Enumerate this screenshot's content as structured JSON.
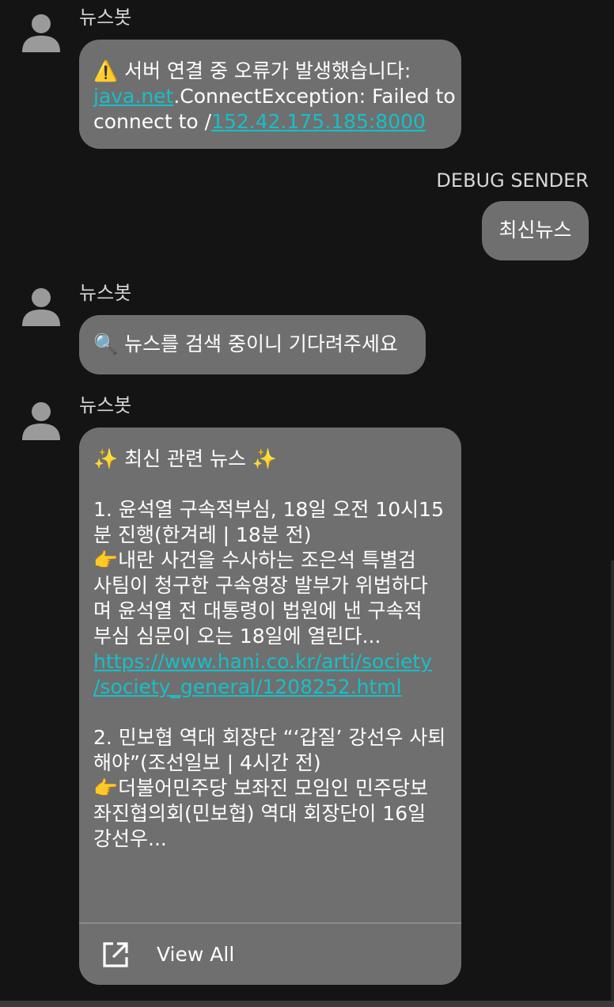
{
  "messages": [
    {
      "sender": "뉴스봇",
      "lines": [
        "⚠️ 서버 연결 중 오류가 발생했습니다:",
        "java.net",
        ".ConnectException: Failed to",
        "connect to /",
        "152.42.175.185:8000"
      ]
    },
    {
      "sender": "DEBUG SENDER",
      "text": "최신뉴스"
    },
    {
      "sender": "뉴스봇",
      "text": "🔍 뉴스를 검색 중이니 기다려주세요"
    },
    {
      "sender": "뉴스봇",
      "header": "✨ 최신 관련 뉴스 ✨",
      "item1": {
        "title_l1": "1. 윤석열 구속적부심, 18일 오전 10시15",
        "title_l2": "분 진행(한겨레 | 18분 전)",
        "body_l1": "👉내란 사건을 수사하는 조은석 특별검",
        "body_l2": "사팀이 청구한 구속영장 발부가 위법하다",
        "body_l3": "며 윤석열 전 대통령이 법원에 낸 구속적",
        "body_l4": "부심 심문이 오는 18일에 열린다...",
        "link_l1": "https://www.hani.co.kr/arti/society",
        "link_l2": "/society_general/1208252.html"
      },
      "item2": {
        "title_l1": "2. 민보협 역대 회장단 “‘갑질’ 강선우 사퇴",
        "title_l2": "해야”(조선일보 | 4시간 전)",
        "body_l1": "👉더불어민주당 보좌진 모임인 민주당보",
        "body_l2": "좌진협의회(민보협) 역대 회장단이 16일",
        "body_l3": "강선우..."
      },
      "view_all_label": "View All",
      "view_all_icon": "open-in-new-icon"
    }
  ],
  "colors": {
    "background": "#141414",
    "bubble": "#6f6f6f",
    "link": "#16c0c8",
    "avatar": "#9a9a9a"
  }
}
